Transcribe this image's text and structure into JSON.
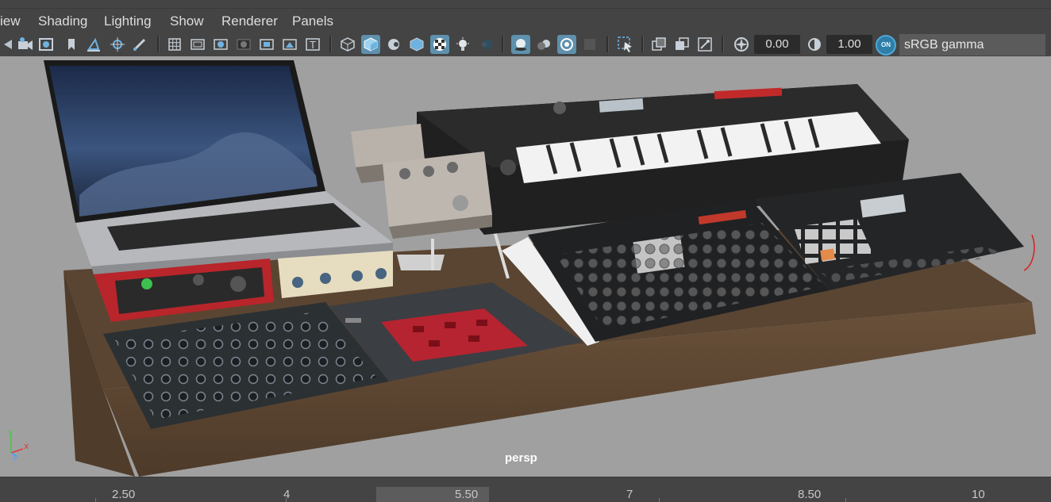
{
  "menubar": {
    "items": [
      "iew",
      "Shading",
      "Lighting",
      "Show",
      "Renderer",
      "Panels"
    ]
  },
  "toolbar": {
    "icons": [
      "camera-attributes-icon",
      "bookmark-icon",
      "snapshot-icon",
      "grid-icon",
      "wireframe-icon",
      "smooth-shade-icon",
      "texture-icon",
      "lights-icon",
      "isolate-select-icon"
    ],
    "exposure_value": "0.00",
    "gamma_value": "1.00",
    "color_management_badge": "ON",
    "color_space": "sRGB gamma"
  },
  "viewport": {
    "camera_label": "persp",
    "axis": {
      "y": "y",
      "x": "x",
      "z": "z"
    },
    "accent_color": "#5e91ad"
  },
  "timeline": {
    "labels": [
      "2.50",
      "4",
      "5.50",
      "7",
      "8.50",
      "10"
    ]
  }
}
